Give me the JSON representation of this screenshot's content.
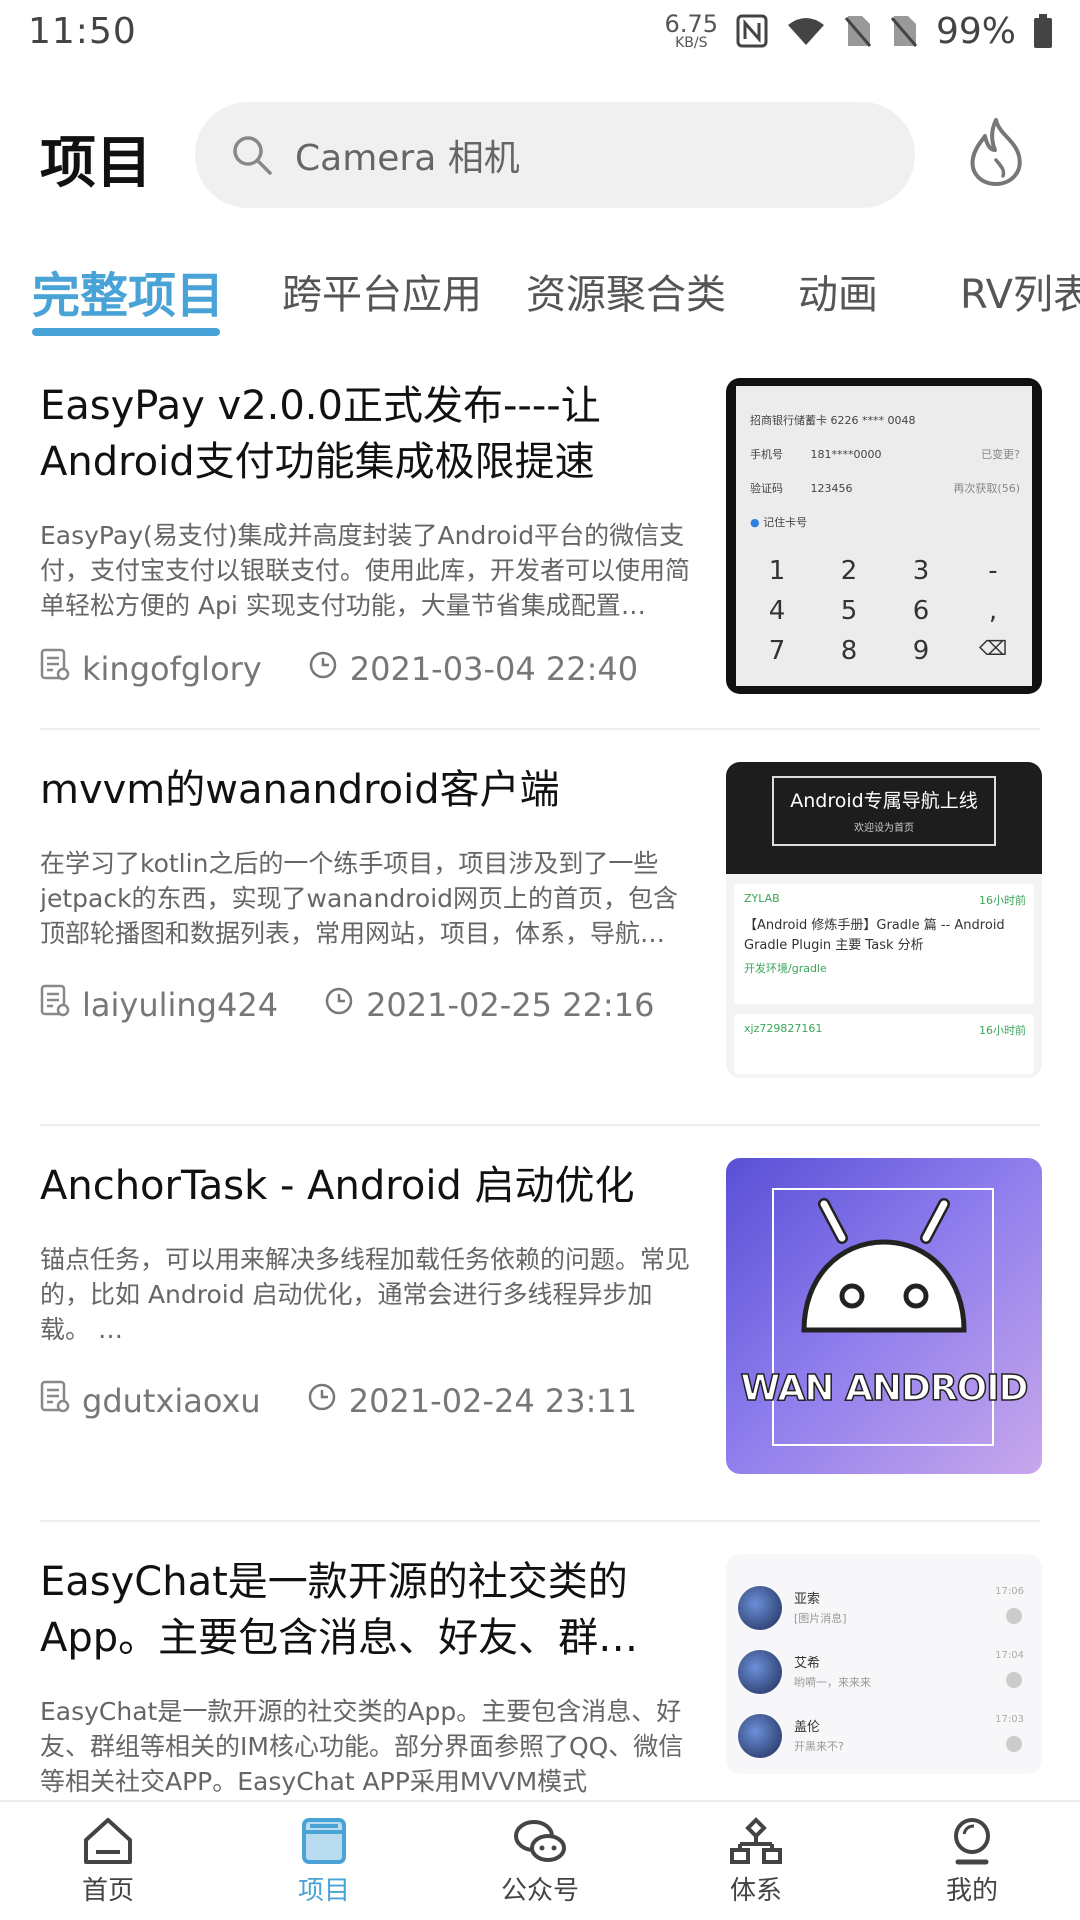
{
  "status_bar": {
    "time": "11:50",
    "net_speed_value": "6.75",
    "net_speed_unit": "KB/S",
    "battery": "99%"
  },
  "header": {
    "title": "项目",
    "search_placeholder": "Camera 相机"
  },
  "tabs": [
    "完整项目",
    "跨平台应用",
    "资源聚合类",
    "动画",
    "RV列表"
  ],
  "articles": [
    {
      "title": "EasyPay v2.0.0正式发布----让Android支付功能集成极限提速",
      "desc": "EasyPay(易支付)集成并高度封装了Android平台的微信支付，支付宝支付以银联支付。使用此库，开发者可以使用简单轻松方便的 Api 实现支付功能，大量节省集成配置…",
      "author": "kingofglory",
      "time": "2021-03-04 22:40"
    },
    {
      "title": "mvvm的wanandroid客户端",
      "desc": "在学习了kotlin之后的一个练手项目，项目涉及到了一些jetpack的东西，实现了wanandroid网页上的首页，包含顶部轮播图和数据列表，常用网站，项目，体系，导航…",
      "author": "laiyuling424",
      "time": "2021-02-25 22:16"
    },
    {
      "title": "AnchorTask - Android 启动优化",
      "desc": "锚点任务，可以用来解决多线程加载任务依赖的问题。常见的，比如 Android 启动优化，通常会进行多线程异步加载。 …",
      "author": "gdutxiaoxu",
      "time": "2021-02-24 23:11"
    },
    {
      "title": "EasyChat是一款开源的社交类的App。主要包含消息、好友、群…",
      "desc": "EasyChat是一款开源的社交类的App。主要包含消息、好友、群组等相关的IM核心功能。部分界面参照了QQ、微信等相关社交APP。EasyChat APP采用MVVM模式",
      "author": "",
      "time": ""
    }
  ],
  "thumb1": {
    "card": "招商银行储蓄卡 6226 **** 0048",
    "phone_label": "手机号",
    "phone_value": "181****0000",
    "phone_change": "已变更?",
    "code_label": "验证码",
    "code_value": "123456",
    "resend": "再次获取(56)",
    "remember": "记住卡号",
    "keys": [
      "1",
      "2",
      "3",
      "-",
      "4",
      "5",
      "6",
      ",",
      "7",
      "8",
      "9",
      "⌫"
    ]
  },
  "thumb2": {
    "banner_title": "Android专属导航上线",
    "banner_sub": "欢迎设为首页",
    "item1_author": "ZYLAB",
    "item1_time": "16小时前",
    "item1_title": "【Android 修炼手册】Gradle 篇 -- Android Gradle Plugin 主要 Task 分析",
    "item1_tag": "开发环境/gradle",
    "item2_author": "xjz729827161",
    "item2_time": "16小时前"
  },
  "thumb3": {
    "label": "WAN ANDROID"
  },
  "thumb4": {
    "chats": [
      {
        "name": "亚索",
        "msg": "[图片消息]",
        "time": "17:06"
      },
      {
        "name": "艾希",
        "msg": "哟嗬一，来来来",
        "time": "17:04"
      },
      {
        "name": "盖伦",
        "msg": "开黑来不?",
        "time": "17:03"
      }
    ]
  },
  "bottom_nav": [
    "首页",
    "项目",
    "公众号",
    "体系",
    "我的"
  ],
  "colors": {
    "accent": "#4aa3d6",
    "search_bg": "#f0f0f0",
    "text_secondary": "#666666"
  }
}
